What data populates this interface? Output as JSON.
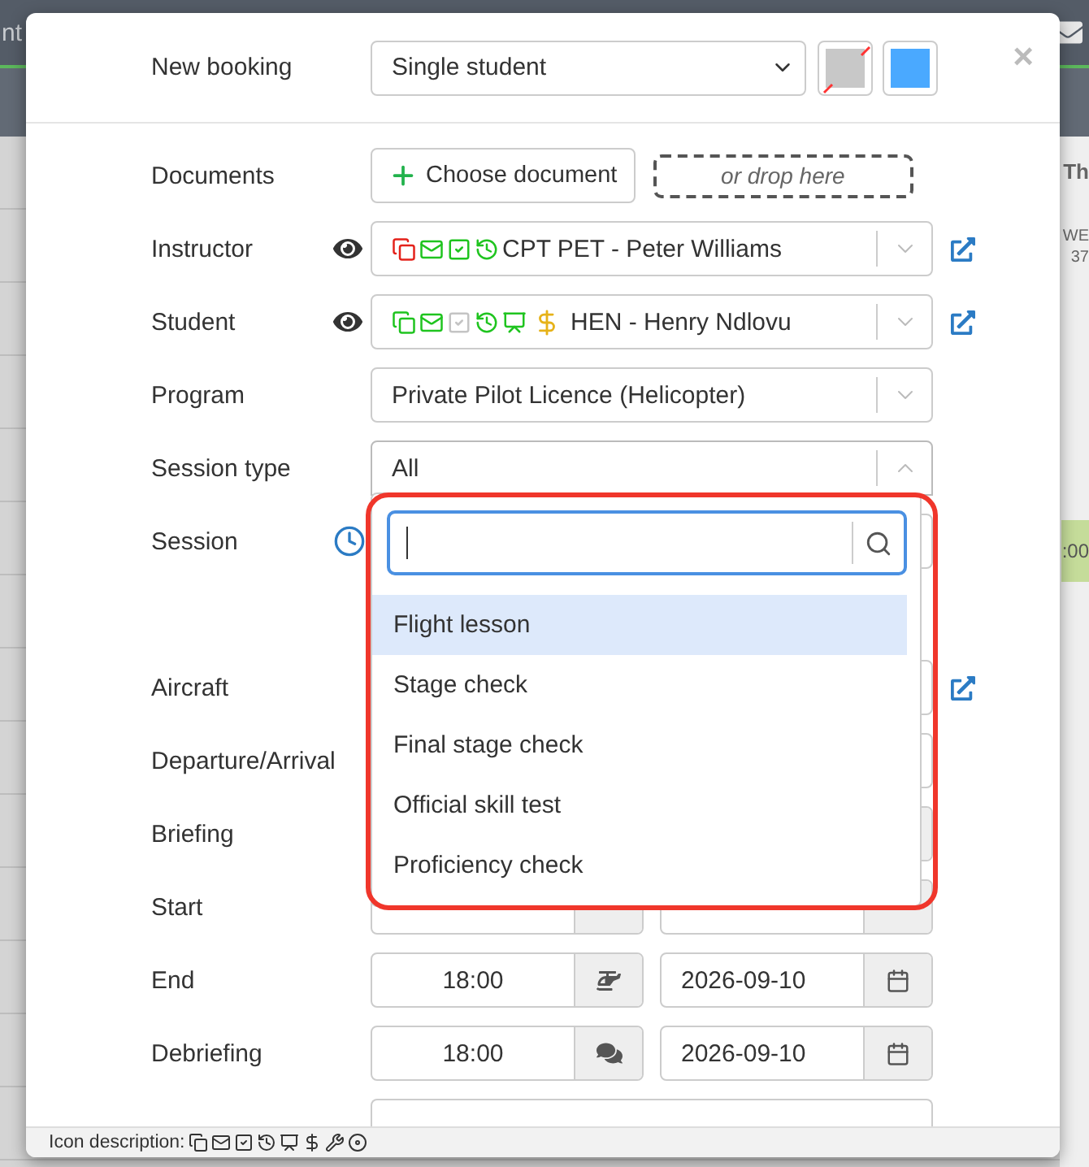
{
  "background": {
    "header_text": "nt",
    "side_texts": [
      "Th",
      "WE",
      "37"
    ],
    "event_text": ":00"
  },
  "dialog": {
    "label": "New booking",
    "booking_type": "Single student",
    "close": "×",
    "swatches": [
      {
        "color": "#c8c8c8",
        "none": true
      },
      {
        "color": "#4aa9ff",
        "none": false
      }
    ]
  },
  "rows": [
    {
      "kind": "documents",
      "label": "Documents",
      "button": "Choose document",
      "drop": "or drop here"
    },
    {
      "kind": "person",
      "label": "Instructor",
      "eye": true,
      "link": true,
      "value": "CPT PET - Peter Williams",
      "icons": [
        {
          "kind": "documents",
          "color": "#e4221b"
        },
        {
          "kind": "email",
          "color": "#1fc41f"
        },
        {
          "kind": "calendar",
          "color": "#1fc41f"
        },
        {
          "kind": "history",
          "color": "#1fc41f"
        }
      ]
    },
    {
      "kind": "person",
      "label": "Student",
      "eye": true,
      "link": true,
      "value": "HEN - Henry Ndlovu",
      "icons": [
        {
          "kind": "documents",
          "color": "#1fc41f"
        },
        {
          "kind": "email",
          "color": "#1fc41f"
        },
        {
          "kind": "calendar",
          "color": "#c4c4c4"
        },
        {
          "kind": "history",
          "color": "#1fc41f"
        },
        {
          "kind": "account",
          "color": "#1fc41f"
        },
        {
          "kind": "payment",
          "color": "#e6b219"
        }
      ]
    },
    {
      "kind": "select",
      "label": "Program",
      "value": "Private Pilot Licence (Helicopter)",
      "expanded": false
    },
    {
      "kind": "select",
      "label": "Session type",
      "value": "All",
      "expanded": true
    },
    {
      "kind": "session",
      "label": "Session"
    },
    {
      "kind": "select",
      "label": "Aircraft",
      "link": true,
      "expanded": false
    },
    {
      "kind": "select",
      "label": "Departure/Arrival",
      "expanded": false
    },
    {
      "kind": "briefing",
      "label": "Briefing"
    },
    {
      "kind": "pair",
      "label": "Start"
    },
    {
      "kind": "landing",
      "label": "End",
      "time": "18:00",
      "date": "2026-09-10"
    },
    {
      "kind": "debrief",
      "label": "Debriefing",
      "time": "18:00",
      "date": "2026-09-10"
    },
    {
      "kind": "textarea"
    }
  ],
  "dropdown": {
    "options": [
      {
        "label": "Flight lesson",
        "selected": true
      },
      {
        "label": "Stage check",
        "selected": false
      },
      {
        "label": "Final stage check",
        "selected": false
      },
      {
        "label": "Official skill test",
        "selected": false
      },
      {
        "label": "Proficiency check",
        "selected": false
      }
    ]
  },
  "footer": {
    "label": "Icon description:"
  }
}
